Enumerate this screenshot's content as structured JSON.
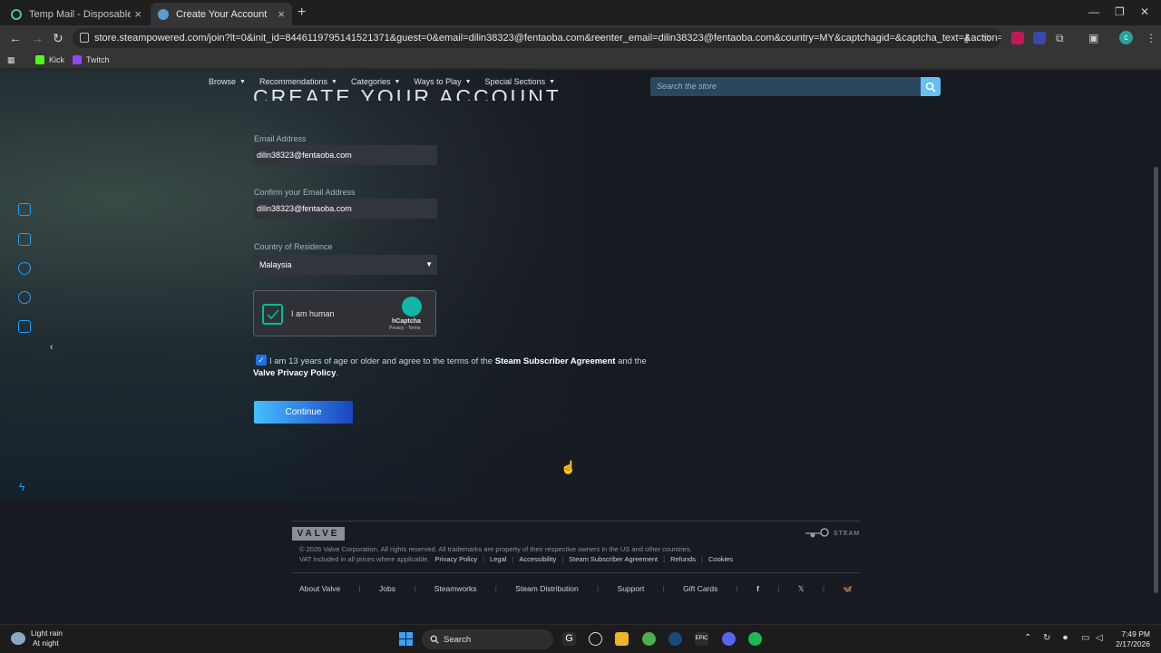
{
  "browser": {
    "tabs": [
      {
        "title": "Temp Mail - Disposable Tempo",
        "active": false
      },
      {
        "title": "Create Your Account",
        "active": true
      }
    ],
    "url": "store.steampowered.com/join?lt=0&init_id=8446119795141521371&guest=0&email=dilin38323@fentaoba.com&reenter_email=dilin38323@fentaoba.com&country=MY&captchagid=&captcha_text=&action=submit_agreement...",
    "bookmarks": [
      {
        "label": "Kick",
        "color": "#53fc18"
      },
      {
        "label": "Twitch",
        "color": "#9146ff"
      }
    ],
    "profile_initial": "c"
  },
  "store_nav": {
    "items": [
      "Browse",
      "Recommendations",
      "Categories",
      "Ways to Play",
      "Special Sections"
    ],
    "search_placeholder": "Search the store"
  },
  "form": {
    "title": "Create Your Account",
    "email_label": "Email Address",
    "email_value": "dilin38323@fentaoba.com",
    "confirm_label": "Confirm your Email Address",
    "confirm_value": "dilin38323@fentaoba.com",
    "country_label": "Country of Residence",
    "country_value": "Malaysia",
    "captcha": {
      "label": "I am human",
      "brand": "hCaptcha",
      "links": "Privacy - Terms",
      "checked": true
    },
    "agreement": {
      "checked": true,
      "prefix": "I am 13 years of age or older and agree to the terms of the",
      "ssa_link": "Steam Subscriber Agreement",
      "middle": "and the",
      "privacy_link": "Valve Privacy Policy",
      "suffix": "."
    },
    "continue_label": "Continue"
  },
  "footer": {
    "valve_logo": "VALVE",
    "steam_logo": "STEAM",
    "copyright": "© 2026 Valve Corporation. All rights reserved. All trademarks are property of their respective owners in the US and other countries.",
    "vat": "VAT included in all prices where applicable.",
    "legal_links": [
      "Privacy Policy",
      "Legal",
      "Accessibility",
      "Steam Subscriber Agreement",
      "Refunds",
      "Cookies"
    ],
    "bottom_links": [
      "About Valve",
      "Jobs",
      "Steamworks",
      "Steam Distribution",
      "Support",
      "Gift Cards"
    ],
    "social": [
      "facebook-icon",
      "x-icon",
      "bluesky-icon"
    ]
  },
  "taskbar": {
    "weather_line1": "Light rain",
    "weather_line2": "At night",
    "weather_badge": "3",
    "search_label": "Search",
    "time": "7:49 PM",
    "date": "2/17/2026"
  },
  "colors": {
    "steam_accent": "#66c0f4",
    "continue_start": "#47bfff",
    "continue_end": "#1a44c2",
    "hcaptcha_green": "#00bf8f"
  }
}
